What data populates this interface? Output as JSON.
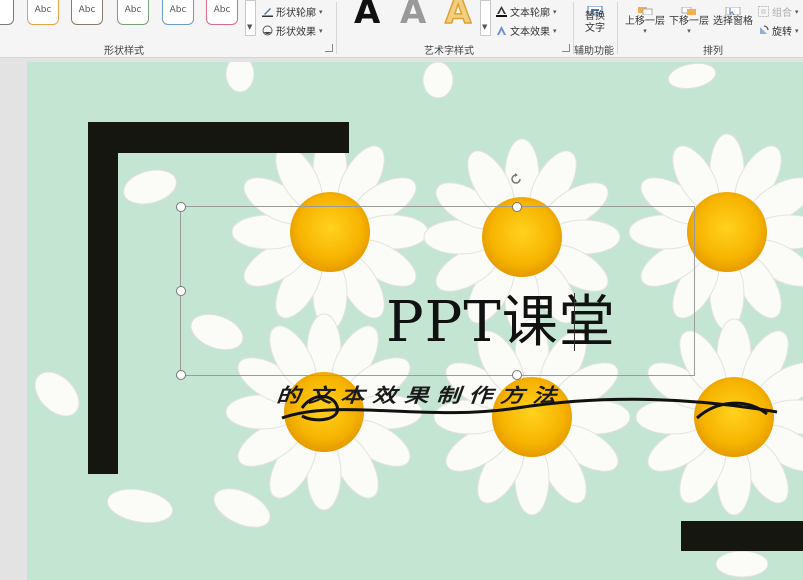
{
  "ribbon": {
    "shape_styles": {
      "swatch_label": "Abc",
      "swatches": [
        {
          "color": "#7a7a7a"
        },
        {
          "color": "#e7a54b"
        },
        {
          "color": "#8a7a6a"
        },
        {
          "color": "#7aa07a"
        },
        {
          "color": "#6a9ad0"
        },
        {
          "color": "#d86a8a"
        }
      ],
      "outline": "形状轮廓",
      "effects": "形状效果",
      "label": "形状样式"
    },
    "wordart": {
      "letter": "A",
      "outline": "文本轮廓",
      "effects": "文本效果",
      "label": "艺术字样式"
    },
    "accessibility": {
      "alt_text_line1": "替换",
      "alt_text_line2": "文字",
      "label": "辅助功能"
    },
    "arrange": {
      "bring_forward": "上移一层",
      "send_backward": "下移一层",
      "selection_pane": "选择窗格",
      "group": "组合",
      "rotate": "旋转",
      "label": "排列"
    }
  },
  "slide": {
    "title": "PPT课堂",
    "wordart_text": "的文本效果制作方法"
  }
}
